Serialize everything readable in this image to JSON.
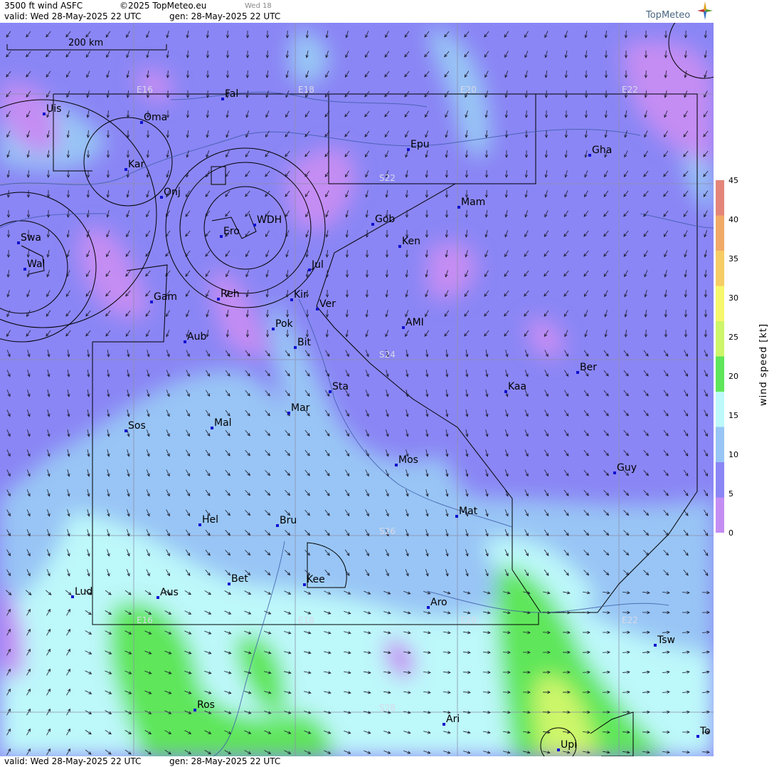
{
  "header": {
    "product": "3500 ft wind ASFC",
    "copyright": "©2025 TopMeteo.eu",
    "tab": "Wed 18",
    "valid": "valid:  Wed  28-May-2025  22 UTC",
    "generated": "gen: 28-May-2025 22 UTC",
    "logo": "TopMeteo"
  },
  "footer": {
    "valid": "valid:  Wed  28-May-2025  22 UTC",
    "generated": "gen: 28-May-2025 22 UTC"
  },
  "scale_bar": "200 km",
  "legend": {
    "title": "wind  speed  [kt]",
    "ticks": [
      "45",
      "40",
      "35",
      "30",
      "25",
      "20",
      "15",
      "10",
      "5",
      "0"
    ],
    "colors": [
      "#e4857a",
      "#f1a968",
      "#f6cc65",
      "#f7f76d",
      "#cdf66a",
      "#5fe65a",
      "#bdf8fa",
      "#98c5f5",
      "#8a86f5",
      "#c48df3"
    ]
  },
  "grid_labels": {
    "lon": [
      "E16",
      "E18",
      "E20",
      "E22",
      "E16",
      "E18",
      "E20",
      "E22"
    ],
    "lat": [
      "S22",
      "S24",
      "S26",
      "S28"
    ]
  },
  "places": [
    {
      "name": "Uis"
    },
    {
      "name": "Fal"
    },
    {
      "name": "Oma"
    },
    {
      "name": "Epu"
    },
    {
      "name": "Gha"
    },
    {
      "name": "Kar"
    },
    {
      "name": "Onj"
    },
    {
      "name": "Mam"
    },
    {
      "name": "Gob"
    },
    {
      "name": "WDH"
    },
    {
      "name": "Swa"
    },
    {
      "name": "Ero"
    },
    {
      "name": "Ken"
    },
    {
      "name": "Wal"
    },
    {
      "name": "Jul"
    },
    {
      "name": "Gam"
    },
    {
      "name": "Reh"
    },
    {
      "name": "Kir"
    },
    {
      "name": "Ver"
    },
    {
      "name": "Pok"
    },
    {
      "name": "AMI"
    },
    {
      "name": "Bit"
    },
    {
      "name": "Aub"
    },
    {
      "name": "Ber"
    },
    {
      "name": "Sta"
    },
    {
      "name": "Kaa"
    },
    {
      "name": "Mar"
    },
    {
      "name": "Sos"
    },
    {
      "name": "Mal"
    },
    {
      "name": "Mos"
    },
    {
      "name": "Guy"
    },
    {
      "name": "Mat"
    },
    {
      "name": "Hel"
    },
    {
      "name": "Bru"
    },
    {
      "name": "Bet"
    },
    {
      "name": "Kee"
    },
    {
      "name": "Lud"
    },
    {
      "name": "Aus"
    },
    {
      "name": "Aro"
    },
    {
      "name": "Tsw"
    },
    {
      "name": "Ros"
    },
    {
      "name": "Ari"
    },
    {
      "name": "To"
    },
    {
      "name": "Upi"
    }
  ]
}
